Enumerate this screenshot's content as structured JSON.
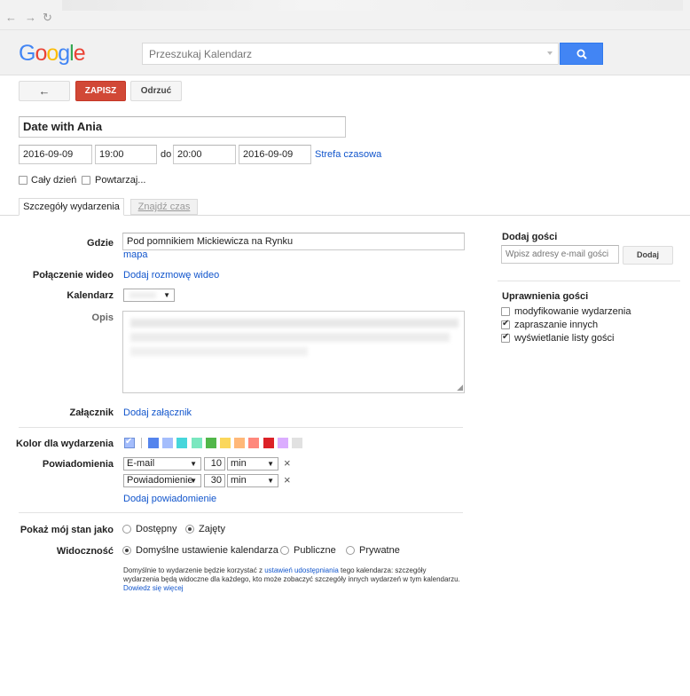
{
  "header": {
    "logo_letters": [
      "G",
      "o",
      "o",
      "g",
      "l",
      "e"
    ],
    "logo_colors": [
      "#4285f4",
      "#ea4335",
      "#fbbc05",
      "#4285f4",
      "#34a853",
      "#ea4335"
    ],
    "search_placeholder": "Przeszukaj Kalendarz"
  },
  "toolbar": {
    "back_icon": "←",
    "save_label": "ZAPISZ",
    "discard_label": "Odrzuć"
  },
  "event": {
    "title": "Date with Ania",
    "start_date": "2016-09-09",
    "start_time": "19:00",
    "to_label": "do",
    "end_time": "20:00",
    "end_date": "2016-09-09",
    "timezone_link": "Strefa czasowa",
    "all_day_label": "Cały dzień",
    "all_day_checked": false,
    "repeat_label": "Powtarzaj...",
    "repeat_checked": false
  },
  "tabs": [
    {
      "label": "Szczegóły wydarzenia",
      "active": true
    },
    {
      "label": "Znajdź czas",
      "active": false
    }
  ],
  "details": {
    "where_label": "Gdzie",
    "where_value": "Pod pomnikiem Mickiewicza na Rynku",
    "map_link": "mapa",
    "video_label": "Połączenie wideo",
    "video_link": "Dodaj rozmowę wideo",
    "calendar_label": "Kalendarz",
    "description_label": "Opis",
    "attachment_label": "Załącznik",
    "attachment_link": "Dodaj załącznik",
    "color_label": "Kolor dla wydarzenia",
    "colors": [
      "#a4bdfc",
      "#5484ed",
      "#a4bdfc",
      "#46d6db",
      "#7ae7bf",
      "#51b749",
      "#fbd75b",
      "#ffb878",
      "#ff887c",
      "#dc2127",
      "#dbadff",
      "#e1e1e1"
    ],
    "notifications_label": "Powiadomienia",
    "notifications": [
      {
        "type": "E-mail",
        "value": "10",
        "unit": "min"
      },
      {
        "type": "Powiadomienie",
        "value": "30",
        "unit": "min"
      }
    ],
    "remove_icon": "×",
    "add_notification_link": "Dodaj powiadomienie",
    "show_as_label": "Pokaż mój stan jako",
    "show_as_options": [
      {
        "label": "Dostępny",
        "checked": false
      },
      {
        "label": "Zajęty",
        "checked": true
      }
    ],
    "visibility_label": "Widoczność",
    "visibility_options": [
      {
        "label": "Domyślne ustawienie kalendarza",
        "checked": true
      },
      {
        "label": "Publiczne",
        "checked": false
      },
      {
        "label": "Prywatne",
        "checked": false
      }
    ],
    "visibility_note_1": "Domyślnie to wydarzenie będzie korzystać z ",
    "visibility_note_link": "ustawień udostępniania",
    "visibility_note_2": " tego kalendarza: szczegóły wydarzenia będą widoczne dla każdego, kto może zobaczyć szczegóły innych wydarzeń w tym kalendarzu.",
    "learn_more_link": "Dowiedz się więcej"
  },
  "guests": {
    "add_title": "Dodaj gości",
    "email_placeholder": "Wpisz adresy e-mail gości",
    "add_button": "Dodaj",
    "permissions_title": "Uprawnienia gości",
    "permissions": [
      {
        "label": "modyfikowanie wydarzenia",
        "checked": false
      },
      {
        "label": "zapraszanie innych",
        "checked": true
      },
      {
        "label": "wyświetlanie listy gości",
        "checked": true
      }
    ]
  }
}
